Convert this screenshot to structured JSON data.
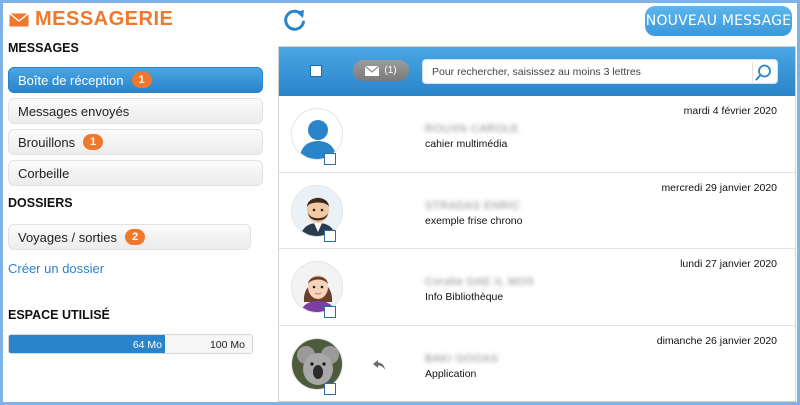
{
  "app": {
    "title": "MESSAGERIE",
    "accent": "#f0782c",
    "primary": "#2a84c9"
  },
  "sidebar": {
    "messages_title": "MESSAGES",
    "items": [
      {
        "label": "Boîte de réception",
        "badge": "1",
        "active": true
      },
      {
        "label": "Messages envoyés",
        "badge": null
      },
      {
        "label": "Brouillons",
        "badge": "1"
      },
      {
        "label": "Corbeille",
        "badge": null
      }
    ],
    "folders_title": "DOSSIERS",
    "folders": [
      {
        "label": "Voyages / sorties",
        "badge": "2"
      }
    ],
    "create_folder": "Créer un dossier",
    "usage_title": "ESPACE UTILISÉ",
    "usage": {
      "used": "64 Mo",
      "total": "100 Mo",
      "fraction": 0.64
    }
  },
  "topbar": {
    "refresh_icon": "refresh-icon",
    "new_message": "NOUVEAU MESSAGE"
  },
  "toolbar": {
    "unread_count": "(1)",
    "search_placeholder": "Pour rechercher, saisissez au moins 3 lettres"
  },
  "messages": [
    {
      "date": "mardi 4 février 2020",
      "sender": "ROUXN CAROLE",
      "subject": "cahier multimédia",
      "avatar": "default-user",
      "replied": false
    },
    {
      "date": "mercredi 29 janvier 2020",
      "sender": "STRADAS ENRIC",
      "subject": "exemple frise chrono",
      "avatar": "man-beard",
      "replied": false
    },
    {
      "date": "lundi 27 janvier 2020",
      "sender": "Coralie DAE IL MOS",
      "subject": "Info Bibliothèque",
      "avatar": "woman",
      "replied": false
    },
    {
      "date": "dimanche 26 janvier 2020",
      "sender": "BAKI GOOAS",
      "subject": "Application",
      "avatar": "koala-photo",
      "replied": true
    }
  ]
}
